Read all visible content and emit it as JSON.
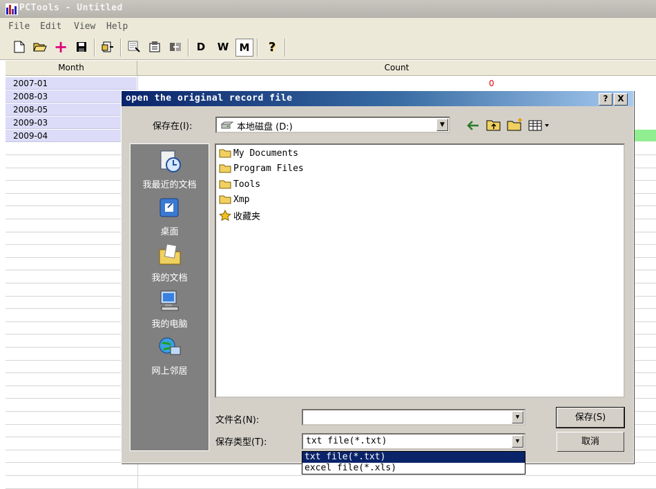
{
  "window": {
    "title": "PCTools - Untitled"
  },
  "menu": [
    "File",
    "Edit",
    "View",
    "Help"
  ],
  "toolbar": {
    "d_label": "D",
    "w_label": "W",
    "m_label": "M",
    "help_label": "?"
  },
  "grid": {
    "columns": [
      "Month",
      "Count"
    ],
    "rows": [
      "2007-01",
      "2008-03",
      "2008-05",
      "2009-03",
      "2009-04"
    ],
    "first_count": "0"
  },
  "dialog": {
    "title": "open the original record file",
    "help_btn": "?",
    "close_btn": "X",
    "save_in_label": "保存在(I):",
    "save_in_value": "本地磁盘 (D:)",
    "places": [
      "我最近的文档",
      "桌面",
      "我的文档",
      "我的电脑",
      "网上邻居"
    ],
    "files": [
      "My Documents",
      "Program Files",
      "Tools",
      "Xmp",
      "收藏夹"
    ],
    "filename_label": "文件名(N):",
    "filename_value": "",
    "filetype_label": "保存类型(T):",
    "filetype_value": "txt file(*.txt)",
    "filetype_options": [
      "txt file(*.txt)",
      "excel file(*.xls)"
    ],
    "save_button": "保存(S)",
    "cancel_button": "取消"
  },
  "colors": {
    "selection": "#0a246a",
    "month_cells": "#dcdcf8",
    "zero_count": "#e00000"
  }
}
